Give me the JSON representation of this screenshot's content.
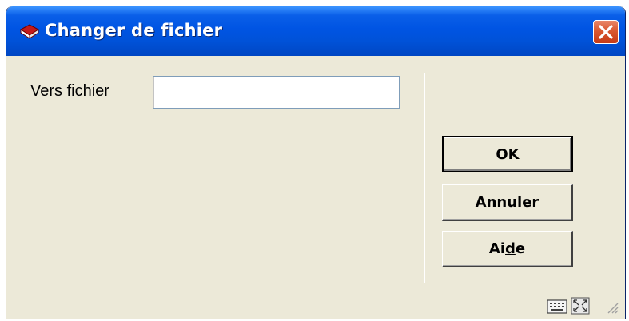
{
  "window": {
    "title": "Changer de fichier",
    "title_icon": "book-icon",
    "close_icon": "close-icon"
  },
  "form": {
    "target_label": "Vers fichier",
    "target_value": "",
    "target_placeholder": ""
  },
  "buttons": {
    "ok_label": "OK",
    "cancel_label": "Annuler",
    "help_label_before": "Ai",
    "help_label_underlined": "d",
    "help_label_after": "e"
  },
  "status_bar": {
    "icons": [
      "keyboard-icon",
      "expand-icon",
      "resize-grip-icon"
    ]
  },
  "colors": {
    "title_bar": "#0054e3",
    "dialog_background": "#ece9d8",
    "close_button": "#d9572f"
  }
}
